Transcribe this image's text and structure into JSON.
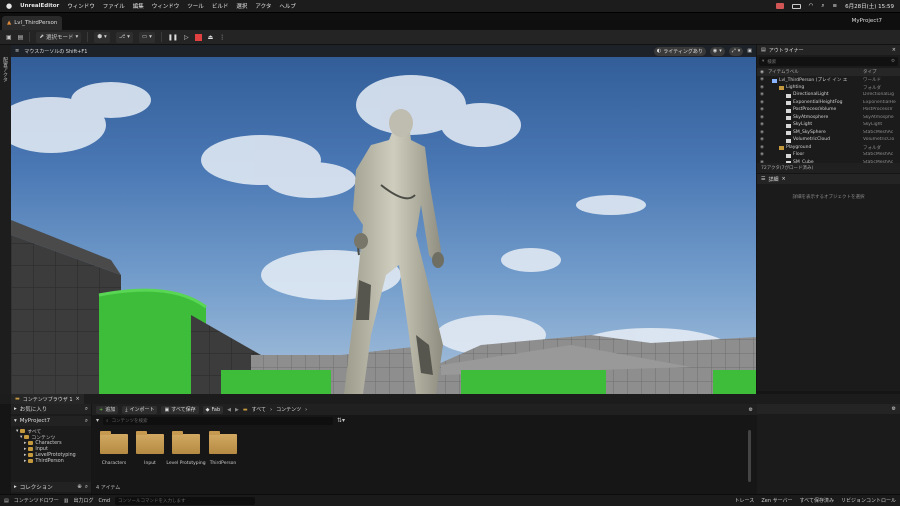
{
  "menubar": {
    "app": "UnrealEditor",
    "items": [
      "ウィンドウ",
      "ファイル",
      "編集",
      "ウィンドウ",
      "ツール",
      "ビルド",
      "選択",
      "アクタ",
      "ヘルプ"
    ],
    "datetime": "6月28日(土) 15:59"
  },
  "tabbar": {
    "level_tab": "Lvl_ThirdPerson",
    "project": "MyProject7"
  },
  "toolbar": {
    "select_mode": "選択モード"
  },
  "viewport": {
    "hint": "マウスカーソルの Shift+F1",
    "lighting_button": "ライティングあり"
  },
  "left_strip": {
    "label": "配置アクタ"
  },
  "outliner": {
    "tab": "アウトライナー",
    "search_placeholder": "検索",
    "col_label": "アイテムラベル",
    "col_type": "タイプ",
    "rows": [
      {
        "name": "Lvl_ThirdPerson (プレイ イン エ",
        "type": "ワールド",
        "indent": 1,
        "icon": "#8ab4ff"
      },
      {
        "name": "Lighting",
        "type": "フォルダ",
        "indent": 2,
        "icon": "#c59a3e"
      },
      {
        "name": "DirectionalLight",
        "type": "DirectionalLig",
        "indent": 3,
        "icon": "#d8d8d8"
      },
      {
        "name": "ExponentialHeightFog",
        "type": "ExponentialHe",
        "indent": 3,
        "icon": "#d8d8d8"
      },
      {
        "name": "PostProcessVolume",
        "type": "PostProcessV",
        "indent": 3,
        "icon": "#d8d8d8"
      },
      {
        "name": "SkyAtmosphere",
        "type": "SkyAtmosphe",
        "indent": 3,
        "icon": "#d8d8d8"
      },
      {
        "name": "SkyLight",
        "type": "SkyLight",
        "indent": 3,
        "icon": "#d8d8d8"
      },
      {
        "name": "SM_SkySphere",
        "type": "StaticMeshAc",
        "indent": 3,
        "icon": "#d8d8d8"
      },
      {
        "name": "VolumetricCloud",
        "type": "VolumetricClo",
        "indent": 3,
        "icon": "#d8d8d8"
      },
      {
        "name": "Playground",
        "type": "フォルダ",
        "indent": 2,
        "icon": "#c59a3e"
      },
      {
        "name": "Floor",
        "type": "StaticMeshAc",
        "indent": 3,
        "icon": "#d8d8d8"
      },
      {
        "name": "SM_Cube",
        "type": "StaticMeshAc",
        "indent": 3,
        "icon": "#d8d8d8"
      }
    ],
    "status": "72アクタ(7がロード済み)"
  },
  "details": {
    "tab": "詳細",
    "empty_text": "詳細を表示するオブジェクトを選択"
  },
  "content_browser": {
    "tab": "コンテンツブラウザ 1",
    "favorites": "お気に入り",
    "project": "MyProject7",
    "tree": [
      "すべて",
      "コンテンツ",
      "Characters",
      "Input",
      "LevelPrototyping",
      "ThirdPerson"
    ],
    "collections": "コレクション",
    "add": "追加",
    "import": "インポート",
    "save_all": "すべて保存",
    "fab": "Fab",
    "breadcrumb": [
      "すべて",
      "コンテンツ"
    ],
    "search_placeholder": "コンテンツを検索",
    "folders": [
      "Characters",
      "Input",
      "Level Prototyping",
      "ThirdPerson"
    ],
    "count": "4 アイテム"
  },
  "statusbar": {
    "content_drawer": "コンテンツドロワー",
    "output_log": "出力ログ",
    "cmd": "Cmd",
    "cmd_placeholder": "コンソールコマンドを入力します",
    "trace": "トレース",
    "zen_server": "Zen サーバー",
    "saved": "すべて保存済み",
    "revision": "リビジョンコントロール"
  }
}
